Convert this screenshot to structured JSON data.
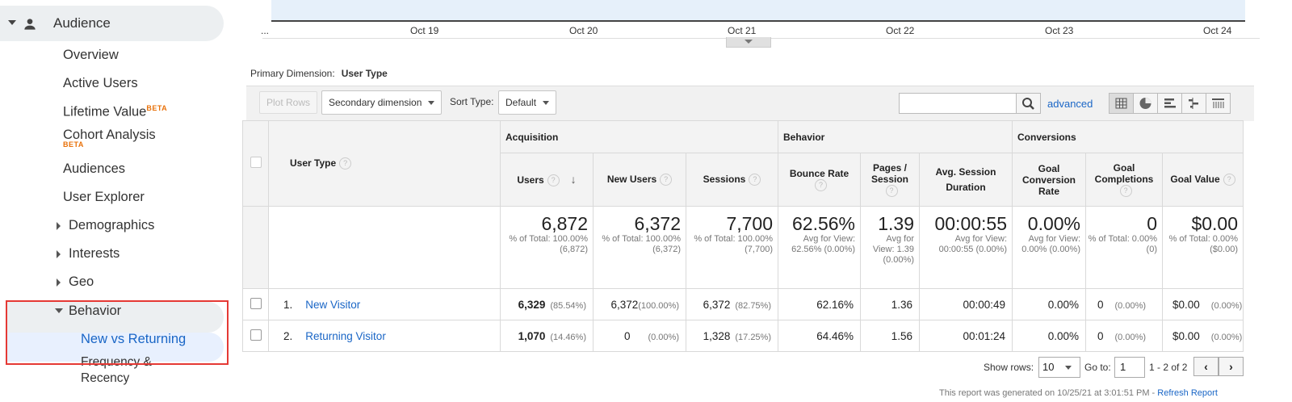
{
  "sidebar": {
    "section": "Audience",
    "items": [
      {
        "label": "Overview"
      },
      {
        "label": "Active Users"
      },
      {
        "label": "Lifetime Value",
        "badge": "BETA"
      },
      {
        "label": "Cohort Analysis",
        "badge": "BETA"
      },
      {
        "label": "Audiences"
      },
      {
        "label": "User Explorer"
      },
      {
        "label": "Demographics"
      },
      {
        "label": "Interests"
      },
      {
        "label": "Geo"
      },
      {
        "label": "Behavior"
      },
      {
        "label": "New vs Returning"
      },
      {
        "label": "Frequency & Recency"
      }
    ]
  },
  "chart": {
    "x_ticks": [
      "...",
      "Oct 19",
      "Oct 20",
      "Oct 21",
      "Oct 22",
      "Oct 23",
      "Oct 24"
    ]
  },
  "primary_dimension": {
    "label": "Primary Dimension:",
    "value": "User Type"
  },
  "toolbar": {
    "plot_rows": "Plot Rows",
    "secondary_dimension": "Secondary dimension",
    "sort_type_label": "Sort Type:",
    "sort_type_value": "Default",
    "search_placeholder": "",
    "advanced": "advanced"
  },
  "table": {
    "dimension_header": "User Type",
    "groups": [
      "Acquisition",
      "Behavior",
      "Conversions"
    ],
    "columns": [
      "Users",
      "New Users",
      "Sessions",
      "Bounce Rate",
      "Pages / Session",
      "Avg. Session Duration",
      "Goal Conversion Rate",
      "Goal Completions",
      "Goal Value"
    ],
    "totals": [
      {
        "value": "6,872",
        "sub": "% of Total: 100.00% (6,872)"
      },
      {
        "value": "6,372",
        "sub": "% of Total: 100.00% (6,372)"
      },
      {
        "value": "7,700",
        "sub": "% of Total: 100.00% (7,700)"
      },
      {
        "value": "62.56%",
        "sub": "Avg for View: 62.56% (0.00%)"
      },
      {
        "value": "1.39",
        "sub": "Avg for View: 1.39 (0.00%)"
      },
      {
        "value": "00:00:55",
        "sub": "Avg for View: 00:00:55 (0.00%)"
      },
      {
        "value": "0.00%",
        "sub": "Avg for View: 0.00% (0.00%)"
      },
      {
        "value": "0",
        "sub": "% of Total: 0.00% (0)"
      },
      {
        "value": "$0.00",
        "sub": "% of Total: 0.00% ($0.00)"
      }
    ],
    "rows": [
      {
        "index": "1.",
        "name": "New Visitor",
        "users": "6,329",
        "users_pct": "(85.54%)",
        "new_users": "6,372",
        "new_users_pct": "(100.00%)",
        "sessions": "6,372",
        "sessions_pct": "(82.75%)",
        "bounce": "62.16%",
        "pages": "1.36",
        "duration": "00:00:49",
        "conv_rate": "0.00%",
        "completions": "0",
        "completions_pct": "(0.00%)",
        "value": "$0.00",
        "value_pct": "(0.00%)"
      },
      {
        "index": "2.",
        "name": "Returning Visitor",
        "users": "1,070",
        "users_pct": "(14.46%)",
        "new_users": "0",
        "new_users_pct": "(0.00%)",
        "sessions": "1,328",
        "sessions_pct": "(17.25%)",
        "bounce": "64.46%",
        "pages": "1.56",
        "duration": "00:01:24",
        "conv_rate": "0.00%",
        "completions": "0",
        "completions_pct": "(0.00%)",
        "value": "$0.00",
        "value_pct": "(0.00%)"
      }
    ]
  },
  "footer": {
    "show_rows_label": "Show rows:",
    "show_rows_value": "10",
    "goto_label": "Go to:",
    "goto_value": "1",
    "range": "1 - 2 of 2",
    "generated": "This report was generated on 10/25/21 at 3:01:51 PM - ",
    "refresh": "Refresh Report"
  }
}
